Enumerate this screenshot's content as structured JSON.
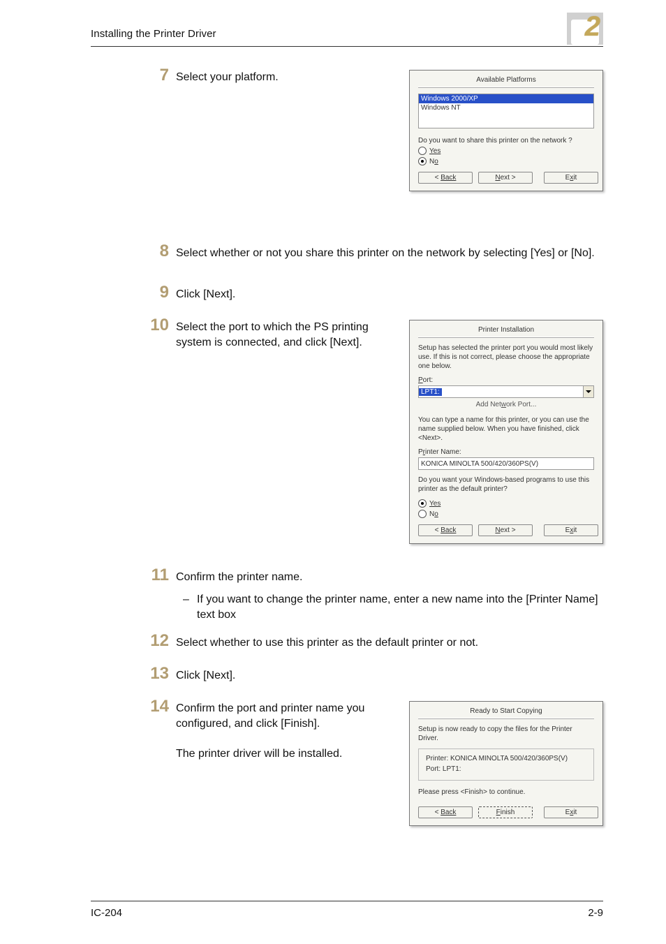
{
  "header": {
    "title": "Installing the Printer Driver"
  },
  "chapter": "2",
  "footer": {
    "left": "IC-204",
    "right": "2-9"
  },
  "steps": {
    "s7": {
      "num": "7",
      "text": "Select your platform."
    },
    "s8": {
      "num": "8",
      "text": "Select whether or not you share this printer on the network by selecting [Yes] or [No]."
    },
    "s9": {
      "num": "9",
      "text": "Click [Next]."
    },
    "s10": {
      "num": "10",
      "text": "Select the port to which the PS printing system is connected, and click [Next]."
    },
    "s11": {
      "num": "11",
      "text": "Confirm the printer name.",
      "sub": "If you want to change the printer name, enter a new name into the [Printer Name] text box"
    },
    "s12": {
      "num": "12",
      "text": "Select whether to use this printer as the default printer or not."
    },
    "s13": {
      "num": "13",
      "text": "Click [Next]."
    },
    "s14": {
      "num": "14",
      "text1": "Confirm the port and printer name you configured, and click [Finish].",
      "text2": "The printer driver will be installed."
    }
  },
  "dlg1": {
    "title": "Available Platforms",
    "list": [
      "Windows 2000/XP",
      "Windows NT"
    ],
    "share_q": "Do you want to share this printer on the network ?",
    "yes": "Yes",
    "no": "No",
    "back": "Back",
    "next": "Next >",
    "exit": "Exit"
  },
  "dlg2": {
    "title": "Printer Installation",
    "desc": "Setup has selected the printer port you would most likely use. If this is not correct, please choose the appropriate one below.",
    "port_lbl": "Port:",
    "port_val": "LPT1:",
    "add_net": "Add Network Port...",
    "name_desc": "You can type a name for this printer, or you can use the name supplied below. When you have finished, click <Next>.",
    "pname_lbl": "Printer Name:",
    "pname_val": "KONICA MINOLTA 500/420/360PS(V)",
    "default_q": "Do you want your Windows-based programs to use this printer as the default printer?",
    "yes": "Yes",
    "no": "No",
    "back": "Back",
    "next": "Next >",
    "exit": "Exit"
  },
  "dlg3": {
    "title": "Ready to Start Copying",
    "desc": "Setup is now ready to copy the files for the Printer Driver.",
    "printer_lbl": "Printer:",
    "printer_val": "KONICA MINOLTA 500/420/360PS(V)",
    "port_lbl": "Port:",
    "port_val": "LPT1:",
    "press": "Please press <Finish> to continue.",
    "back": "Back",
    "finish": "Finish",
    "exit": "Exit"
  }
}
